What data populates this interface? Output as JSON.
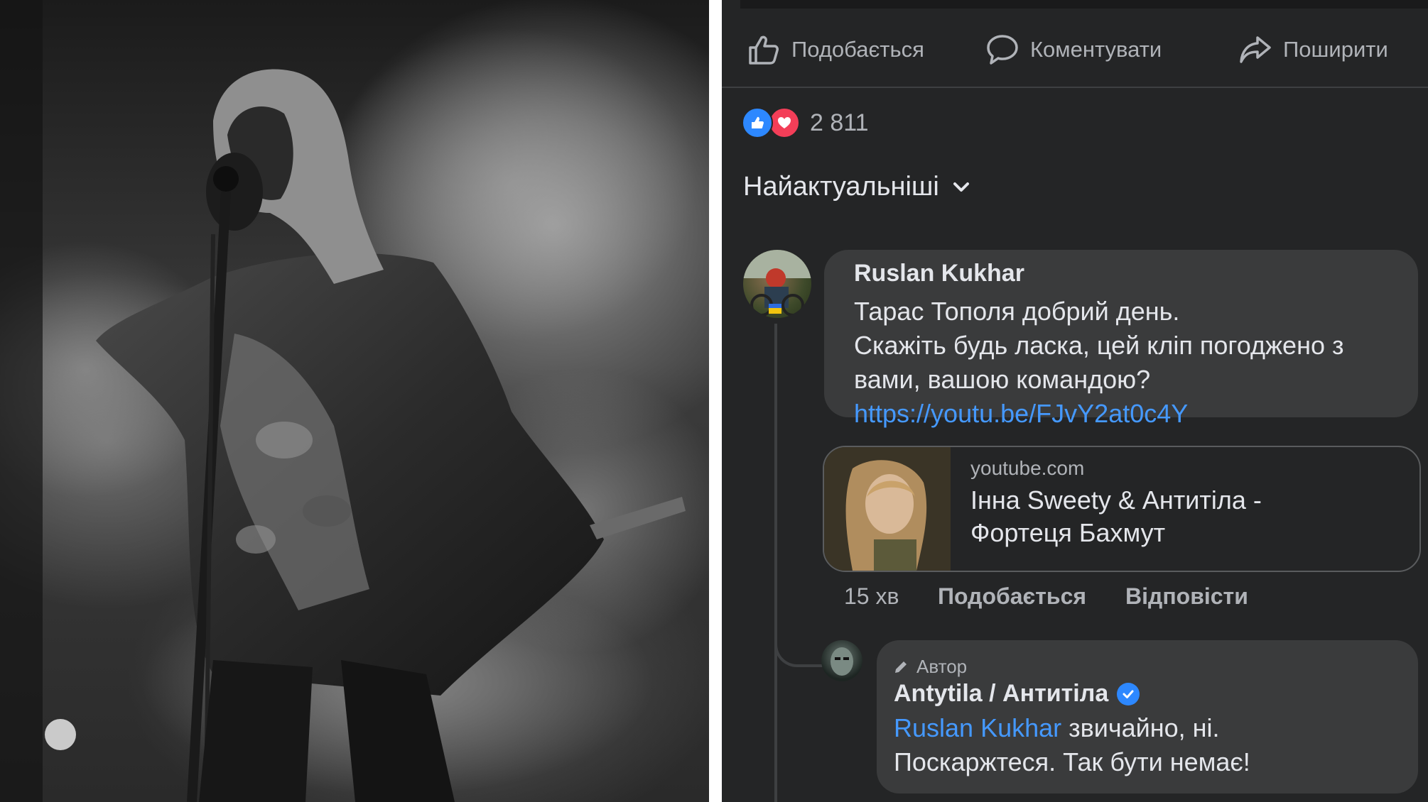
{
  "post_actions": {
    "like": {
      "label": "Подобається",
      "icon": "thumbs-up-icon"
    },
    "comment": {
      "label": "Коментувати",
      "icon": "comment-bubble-icon"
    },
    "share": {
      "label": "Поширити",
      "icon": "share-arrow-icon"
    }
  },
  "reactions": {
    "count": "2 811",
    "types": [
      "like",
      "love"
    ],
    "colors": {
      "like": "#2d88ff",
      "love": "#f33e58"
    }
  },
  "comment_sort": {
    "label": "Найактуальніші",
    "icon": "chevron-down-icon"
  },
  "comment": {
    "author": "Ruslan Kukhar",
    "lines": [
      "Тарас Тополя добрий день.",
      "Скажіть будь ласка, цей кліп погоджено з",
      "вами, вашою командою?"
    ],
    "link": "https://youtu.be/FJvY2at0c4Y",
    "preview": {
      "domain": "youtube.com",
      "title_lines": [
        "Інна Sweety & Антитіла -",
        "Фортеця Бахмут"
      ]
    },
    "time": "15 хв",
    "like_label": "Подобається",
    "reply_label": "Відповісти"
  },
  "reply": {
    "badge": "Автор",
    "author": "Antytila / Антитіла",
    "mention": "Ruslan Kukhar",
    "line1_rest": " звичайно, ні.",
    "line2": "Поскаржтеся. Так бути немає!"
  },
  "theme": {
    "background": "#242526",
    "bubble": "#3a3b3c",
    "link": "#4599ff",
    "text": "#e4e6eb",
    "muted": "#b0b3b8"
  }
}
